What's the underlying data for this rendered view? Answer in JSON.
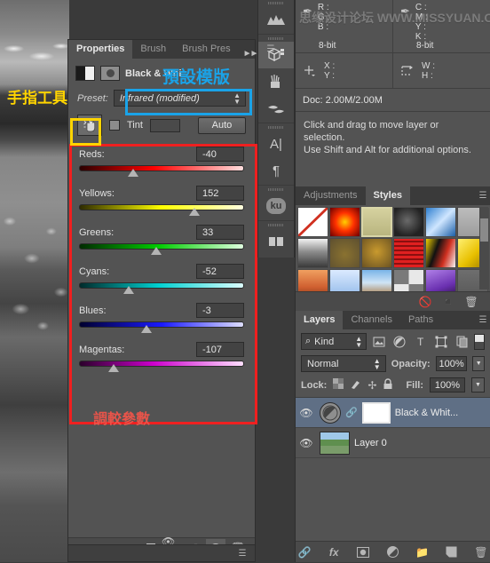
{
  "properties_panel": {
    "tabs": [
      {
        "label": "Properties",
        "active": true
      },
      {
        "label": "Brush",
        "active": false
      },
      {
        "label": "Brush Pres",
        "active": false
      }
    ],
    "overflow_label": "»",
    "title": "Black & Whi",
    "preset_label": "Preset:",
    "preset_value": "Infrared (modified)",
    "tint_label": "Tint",
    "auto_label": "Auto",
    "sliders": [
      {
        "name": "Reds:",
        "value": "-40",
        "pos_pct": 33
      },
      {
        "name": "Yellows:",
        "value": "152",
        "pos_pct": 70
      },
      {
        "name": "Greens:",
        "value": "33",
        "pos_pct": 47
      },
      {
        "name": "Cyans:",
        "value": "-52",
        "pos_pct": 30
      },
      {
        "name": "Blues:",
        "value": "-3",
        "pos_pct": 41
      },
      {
        "name": "Magentas:",
        "value": "-107",
        "pos_pct": 21
      }
    ],
    "footer_icons": [
      "clip-to-layer-icon",
      "preview-previous-icon",
      "reset-icon",
      "toggle-visibility-icon",
      "delete-icon"
    ]
  },
  "icon_dock": {
    "items": [
      {
        "icon": "histogram-icon",
        "active": false
      },
      {
        "icon": "3d-icon",
        "active": true
      },
      {
        "icon": "brushes-icon",
        "active": false
      },
      {
        "icon": "clone-source-icon",
        "active": false
      },
      {
        "icon": "character-icon",
        "label": "A",
        "active": false
      },
      {
        "icon": "paragraph-icon",
        "label": "¶",
        "active": false
      },
      {
        "icon": "ku-icon",
        "label": "ku",
        "active": false
      },
      {
        "icon": "notes-icon",
        "active": false
      }
    ]
  },
  "info_panel": {
    "left_readout": {
      "channels": [
        "R :",
        "G :",
        "B :"
      ],
      "depth": "8-bit"
    },
    "right_readout": {
      "channels": [
        "C :",
        "M :",
        "Y :",
        "K :"
      ],
      "depth": "8-bit"
    },
    "coords": {
      "x_label": "X :",
      "y_label": "Y :",
      "w_label": "W :",
      "h_label": "H :"
    },
    "doc_label": "Doc: 2.00M/2.00M",
    "hint_line1": "Click and drag to move layer or selection.",
    "hint_line2": "Use Shift and Alt for additional options.",
    "watermark": "思缘设计论坛  WWW.MISSYUAN.COM"
  },
  "styles_panel": {
    "tabs": [
      {
        "label": "Adjustments",
        "active": false
      },
      {
        "label": "Styles",
        "active": true
      }
    ],
    "swatches": [
      {
        "name": "none",
        "css": "linear-gradient(135deg,#fff 0%,#fff 100%)",
        "selected": false
      },
      {
        "name": "red-glow",
        "css": "radial-gradient(circle at 50% 50%,#ffd000 0%,#ff3000 45%,#6b0000 100%)",
        "selected": false
      },
      {
        "name": "beveled-frame",
        "css": "linear-gradient(180deg,#d6d2a0,#b8b47e)",
        "selected": true
      },
      {
        "name": "dark-swirl",
        "css": "radial-gradient(circle at 45% 45%,#6a6a6a 0%,#222 70%)",
        "selected": false
      },
      {
        "name": "blue-fold",
        "css": "linear-gradient(135deg,#2e7fd0 0%,#cfe6ff 50%,#1b5fa8 100%)",
        "selected": false
      },
      {
        "name": "grey-flat",
        "css": "linear-gradient(180deg,#bdbdbd,#9d9d9d)",
        "selected": false
      },
      {
        "name": "chrome",
        "css": "linear-gradient(180deg,#f2f2f2 0%,#8c8c8c 45%,#3a3a3a 100%)",
        "selected": false
      },
      {
        "name": "olive-soft",
        "css": "radial-gradient(circle at 50% 55%,#8a7230 0%,#5e5030 100%)",
        "selected": false
      },
      {
        "name": "gold-soft",
        "css": "radial-gradient(circle at 50% 45%,#c99a2e 0%,#6a5222 100%)",
        "selected": false
      },
      {
        "name": "red-stripes",
        "css": "repeating-linear-gradient(0deg,#e02020 0 3px,#8a0f0f 3px 5px)",
        "selected": false
      },
      {
        "name": "graffiti",
        "css": "linear-gradient(110deg,#f0d000 0%,#111 35%,#d03020 65%,#f5f5f5 100%)",
        "selected": false
      },
      {
        "name": "yellow-glass",
        "css": "linear-gradient(135deg,#fff070 0%,#e8c000 55%,#9a7a00 100%)",
        "selected": false
      },
      {
        "name": "sunset",
        "css": "linear-gradient(180deg,#f0a060 0%,#d06030 60%,#8a3a18 100%)",
        "selected": false
      },
      {
        "name": "sky-soft",
        "css": "linear-gradient(180deg,#dbeaff 0%,#8fb8e8 100%)",
        "selected": false
      },
      {
        "name": "horizon",
        "css": "linear-gradient(180deg,#79b4e8 0%,#cfe4f5 45%,#a06828 100%)",
        "selected": false
      },
      {
        "name": "noise",
        "css": "repeating-conic-gradient(#e8e8e8 0% 25%,#7a7a7a 0% 50%)",
        "selected": false
      },
      {
        "name": "purple-cube",
        "css": "linear-gradient(160deg,#b080e8 0%,#6a30b0 60%,#2a1040 100%)",
        "selected": false
      },
      {
        "name": "shadow-box",
        "css": "linear-gradient(180deg,#6e6e6e,#585858)",
        "selected": false
      }
    ],
    "footer_icons": [
      "clear-style-icon",
      "new-style-icon",
      "delete-style-icon"
    ]
  },
  "layers_panel": {
    "tabs": [
      {
        "label": "Layers",
        "active": true
      },
      {
        "label": "Channels",
        "active": false
      },
      {
        "label": "Paths",
        "active": false
      }
    ],
    "filter_label": "Kind",
    "filter_icons": [
      "pixel-layer-icon",
      "adjustment-layer-icon",
      "type-layer-icon",
      "shape-layer-icon",
      "smart-object-icon"
    ],
    "blend_mode": "Normal",
    "opacity_label": "Opacity:",
    "opacity_value": "100%",
    "lock_label": "Lock:",
    "lock_icons": [
      "lock-transparency-icon",
      "lock-image-icon",
      "lock-position-icon",
      "lock-all-icon"
    ],
    "fill_label": "Fill:",
    "fill_value": "100%",
    "layers": [
      {
        "name": "Black & Whit...",
        "type": "adjustment",
        "selected": true,
        "visible": true
      },
      {
        "name": "Layer 0",
        "type": "image",
        "selected": false,
        "visible": true
      }
    ],
    "footer_icons": [
      "link-layers-icon",
      "layer-style-icon",
      "layer-mask-icon",
      "new-adjustment-icon",
      "new-group-icon",
      "new-layer-icon",
      "delete-layer-icon"
    ]
  },
  "annotations": {
    "hand_tool": "手指工具",
    "preset_template": "預設模版",
    "adjust_params": "調較參數",
    "color_hand": "#ffd400",
    "color_preset": "#1aa3e8",
    "color_params": "#ef2020"
  }
}
